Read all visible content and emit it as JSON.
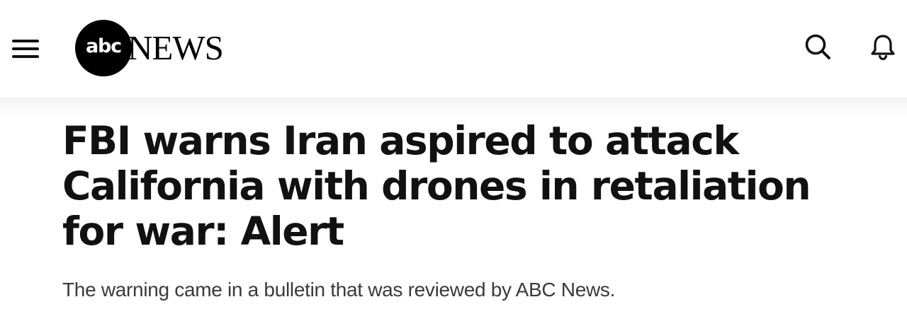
{
  "header": {
    "logo": {
      "mark_text": "abc",
      "wordmark": "NEWS"
    },
    "menu_icon": "hamburger-menu-icon",
    "search_icon": "search-icon",
    "notification_icon": "bell-icon"
  },
  "article": {
    "headline": "FBI warns Iran aspired to attack California with drones in retaliation for war: Alert",
    "subheadline": "The warning came in a bulletin that was reviewed by ABC News."
  },
  "colors": {
    "text": "#111111",
    "subtext": "#3a3a3a",
    "logo_background": "#000000",
    "page_background": "#ffffff"
  }
}
